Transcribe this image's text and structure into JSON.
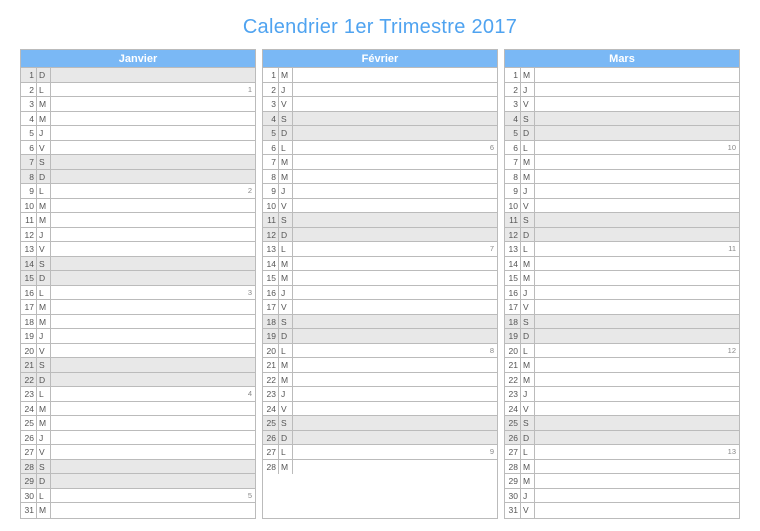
{
  "title": "Calendrier 1er Trimestre 2017",
  "months": [
    {
      "name": "Janvier",
      "days": [
        {
          "n": 1,
          "d": "D",
          "w": true,
          "note": ""
        },
        {
          "n": 2,
          "d": "L",
          "w": false,
          "note": "1"
        },
        {
          "n": 3,
          "d": "M",
          "w": false,
          "note": ""
        },
        {
          "n": 4,
          "d": "M",
          "w": false,
          "note": ""
        },
        {
          "n": 5,
          "d": "J",
          "w": false,
          "note": ""
        },
        {
          "n": 6,
          "d": "V",
          "w": false,
          "note": ""
        },
        {
          "n": 7,
          "d": "S",
          "w": true,
          "note": ""
        },
        {
          "n": 8,
          "d": "D",
          "w": true,
          "note": ""
        },
        {
          "n": 9,
          "d": "L",
          "w": false,
          "note": "2"
        },
        {
          "n": 10,
          "d": "M",
          "w": false,
          "note": ""
        },
        {
          "n": 11,
          "d": "M",
          "w": false,
          "note": ""
        },
        {
          "n": 12,
          "d": "J",
          "w": false,
          "note": ""
        },
        {
          "n": 13,
          "d": "V",
          "w": false,
          "note": ""
        },
        {
          "n": 14,
          "d": "S",
          "w": true,
          "note": ""
        },
        {
          "n": 15,
          "d": "D",
          "w": true,
          "note": ""
        },
        {
          "n": 16,
          "d": "L",
          "w": false,
          "note": "3"
        },
        {
          "n": 17,
          "d": "M",
          "w": false,
          "note": ""
        },
        {
          "n": 18,
          "d": "M",
          "w": false,
          "note": ""
        },
        {
          "n": 19,
          "d": "J",
          "w": false,
          "note": ""
        },
        {
          "n": 20,
          "d": "V",
          "w": false,
          "note": ""
        },
        {
          "n": 21,
          "d": "S",
          "w": true,
          "note": ""
        },
        {
          "n": 22,
          "d": "D",
          "w": true,
          "note": ""
        },
        {
          "n": 23,
          "d": "L",
          "w": false,
          "note": "4"
        },
        {
          "n": 24,
          "d": "M",
          "w": false,
          "note": ""
        },
        {
          "n": 25,
          "d": "M",
          "w": false,
          "note": ""
        },
        {
          "n": 26,
          "d": "J",
          "w": false,
          "note": ""
        },
        {
          "n": 27,
          "d": "V",
          "w": false,
          "note": ""
        },
        {
          "n": 28,
          "d": "S",
          "w": true,
          "note": ""
        },
        {
          "n": 29,
          "d": "D",
          "w": true,
          "note": ""
        },
        {
          "n": 30,
          "d": "L",
          "w": false,
          "note": "5"
        },
        {
          "n": 31,
          "d": "M",
          "w": false,
          "note": ""
        }
      ]
    },
    {
      "name": "Février",
      "days": [
        {
          "n": 1,
          "d": "M",
          "w": false,
          "note": ""
        },
        {
          "n": 2,
          "d": "J",
          "w": false,
          "note": ""
        },
        {
          "n": 3,
          "d": "V",
          "w": false,
          "note": ""
        },
        {
          "n": 4,
          "d": "S",
          "w": true,
          "note": ""
        },
        {
          "n": 5,
          "d": "D",
          "w": true,
          "note": ""
        },
        {
          "n": 6,
          "d": "L",
          "w": false,
          "note": "6"
        },
        {
          "n": 7,
          "d": "M",
          "w": false,
          "note": ""
        },
        {
          "n": 8,
          "d": "M",
          "w": false,
          "note": ""
        },
        {
          "n": 9,
          "d": "J",
          "w": false,
          "note": ""
        },
        {
          "n": 10,
          "d": "V",
          "w": false,
          "note": ""
        },
        {
          "n": 11,
          "d": "S",
          "w": true,
          "note": ""
        },
        {
          "n": 12,
          "d": "D",
          "w": true,
          "note": ""
        },
        {
          "n": 13,
          "d": "L",
          "w": false,
          "note": "7"
        },
        {
          "n": 14,
          "d": "M",
          "w": false,
          "note": ""
        },
        {
          "n": 15,
          "d": "M",
          "w": false,
          "note": ""
        },
        {
          "n": 16,
          "d": "J",
          "w": false,
          "note": ""
        },
        {
          "n": 17,
          "d": "V",
          "w": false,
          "note": ""
        },
        {
          "n": 18,
          "d": "S",
          "w": true,
          "note": ""
        },
        {
          "n": 19,
          "d": "D",
          "w": true,
          "note": ""
        },
        {
          "n": 20,
          "d": "L",
          "w": false,
          "note": "8"
        },
        {
          "n": 21,
          "d": "M",
          "w": false,
          "note": ""
        },
        {
          "n": 22,
          "d": "M",
          "w": false,
          "note": ""
        },
        {
          "n": 23,
          "d": "J",
          "w": false,
          "note": ""
        },
        {
          "n": 24,
          "d": "V",
          "w": false,
          "note": ""
        },
        {
          "n": 25,
          "d": "S",
          "w": true,
          "note": ""
        },
        {
          "n": 26,
          "d": "D",
          "w": true,
          "note": ""
        },
        {
          "n": 27,
          "d": "L",
          "w": false,
          "note": "9"
        },
        {
          "n": 28,
          "d": "M",
          "w": false,
          "note": ""
        }
      ]
    },
    {
      "name": "Mars",
      "days": [
        {
          "n": 1,
          "d": "M",
          "w": false,
          "note": ""
        },
        {
          "n": 2,
          "d": "J",
          "w": false,
          "note": ""
        },
        {
          "n": 3,
          "d": "V",
          "w": false,
          "note": ""
        },
        {
          "n": 4,
          "d": "S",
          "w": true,
          "note": ""
        },
        {
          "n": 5,
          "d": "D",
          "w": true,
          "note": ""
        },
        {
          "n": 6,
          "d": "L",
          "w": false,
          "note": "10"
        },
        {
          "n": 7,
          "d": "M",
          "w": false,
          "note": ""
        },
        {
          "n": 8,
          "d": "M",
          "w": false,
          "note": ""
        },
        {
          "n": 9,
          "d": "J",
          "w": false,
          "note": ""
        },
        {
          "n": 10,
          "d": "V",
          "w": false,
          "note": ""
        },
        {
          "n": 11,
          "d": "S",
          "w": true,
          "note": ""
        },
        {
          "n": 12,
          "d": "D",
          "w": true,
          "note": ""
        },
        {
          "n": 13,
          "d": "L",
          "w": false,
          "note": "11"
        },
        {
          "n": 14,
          "d": "M",
          "w": false,
          "note": ""
        },
        {
          "n": 15,
          "d": "M",
          "w": false,
          "note": ""
        },
        {
          "n": 16,
          "d": "J",
          "w": false,
          "note": ""
        },
        {
          "n": 17,
          "d": "V",
          "w": false,
          "note": ""
        },
        {
          "n": 18,
          "d": "S",
          "w": true,
          "note": ""
        },
        {
          "n": 19,
          "d": "D",
          "w": true,
          "note": ""
        },
        {
          "n": 20,
          "d": "L",
          "w": false,
          "note": "12"
        },
        {
          "n": 21,
          "d": "M",
          "w": false,
          "note": ""
        },
        {
          "n": 22,
          "d": "M",
          "w": false,
          "note": ""
        },
        {
          "n": 23,
          "d": "J",
          "w": false,
          "note": ""
        },
        {
          "n": 24,
          "d": "V",
          "w": false,
          "note": ""
        },
        {
          "n": 25,
          "d": "S",
          "w": true,
          "note": ""
        },
        {
          "n": 26,
          "d": "D",
          "w": true,
          "note": ""
        },
        {
          "n": 27,
          "d": "L",
          "w": false,
          "note": "13"
        },
        {
          "n": 28,
          "d": "M",
          "w": false,
          "note": ""
        },
        {
          "n": 29,
          "d": "M",
          "w": false,
          "note": ""
        },
        {
          "n": 30,
          "d": "J",
          "w": false,
          "note": ""
        },
        {
          "n": 31,
          "d": "V",
          "w": false,
          "note": ""
        }
      ]
    }
  ]
}
